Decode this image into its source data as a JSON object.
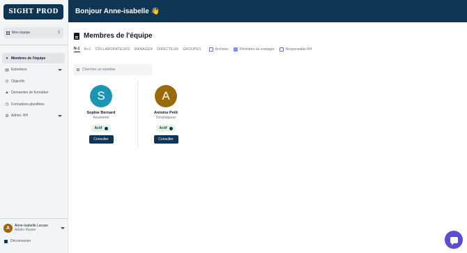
{
  "app": {
    "logo": "SIGHT PROD"
  },
  "sidebar": {
    "company_select": "Mon équipe",
    "items": [
      {
        "label": "Membres de l'équipe",
        "active": true,
        "icon": "users-icon",
        "expandable": false
      },
      {
        "label": "Entretiens",
        "active": false,
        "icon": "calendar-icon",
        "expandable": true
      },
      {
        "label": "Objectifs",
        "active": false,
        "icon": "target-icon",
        "expandable": false
      },
      {
        "label": "Demandes de formation",
        "active": false,
        "icon": "graduation-icon",
        "expandable": false
      },
      {
        "label": "Formations planifiées",
        "active": false,
        "icon": "clock-icon",
        "expandable": false
      },
      {
        "label": "Admin. RH",
        "active": false,
        "icon": "admin-icon",
        "expandable": true
      }
    ],
    "user": {
      "initial": "A",
      "name": "Anne-Isabelle Lacaze",
      "role": "Admin Master"
    },
    "logout_label": "Déconnexion"
  },
  "header": {
    "greeting": "Bonjour Anne-isabelle 👋"
  },
  "main": {
    "title": "Membres de l'équipe",
    "tabs": [
      "N-1",
      "N+1",
      "COLLABORATEURS",
      "MANAGER",
      "DIRECTEUR",
      "GROUPES"
    ],
    "filters": [
      {
        "label": "Archivés",
        "checked": false
      },
      {
        "label": "Périmètre du manager",
        "checked": true
      },
      {
        "label": "Responsable RH",
        "checked": false
      }
    ],
    "search_placeholder": "Chercher un membre",
    "members": [
      {
        "initial": "S",
        "name": "Sophie Bernard",
        "job": "Assistante",
        "status": "Actif",
        "button": "Consulter",
        "color": "#1c95b5"
      },
      {
        "initial": "A",
        "name": "Antoine Petit",
        "job": "Développeur",
        "status": "Actif",
        "button": "Consulter",
        "color": "#9a6a0a"
      }
    ]
  },
  "colors": {
    "primary": "#0f3554",
    "chat": "#5b4bd6",
    "active_badge_bg": "#e5f3ea"
  }
}
